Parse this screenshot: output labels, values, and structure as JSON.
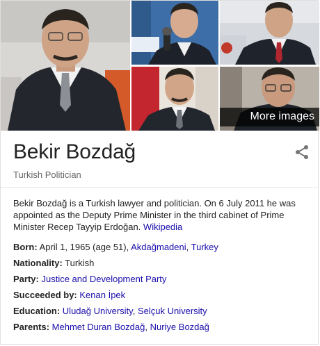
{
  "more_images_label": "More images",
  "entity": {
    "name": "Bekir Bozdağ",
    "type": "Turkish Politician"
  },
  "description": {
    "text": "Bekir Bozdağ is a Turkish lawyer and politician. On 6 July 2011 he was appointed as the Deputy Prime Minister in the third cabinet of Prime Minister Recep Tayyip Erdoğan.",
    "source_link": "Wikipedia"
  },
  "facts": {
    "born": {
      "label": "Born:",
      "date": "April 1, 1965 (age 51),",
      "place_1": "Akdağmadeni",
      "sep": ",",
      "place_2": "Turkey"
    },
    "nationality": {
      "label": "Nationality:",
      "value": "Turkish"
    },
    "party": {
      "label": "Party:",
      "value": "Justice and Development Party"
    },
    "succeeded_by": {
      "label": "Succeeded by:",
      "value": "Kenan İpek"
    },
    "education": {
      "label": "Education:",
      "value_1": "Uludağ University",
      "sep": ",",
      "value_2": "Selçuk University"
    },
    "parents": {
      "label": "Parents:",
      "value_1": "Mehmet Duran Bozdağ",
      "sep": ",",
      "value_2": "Nuriye Bozdağ"
    }
  },
  "colors": {
    "link": "#1a0dab",
    "label_gray": "#666666",
    "overlay": "rgba(0,0,0,0.72)"
  },
  "icons": {
    "share": "share-icon"
  }
}
